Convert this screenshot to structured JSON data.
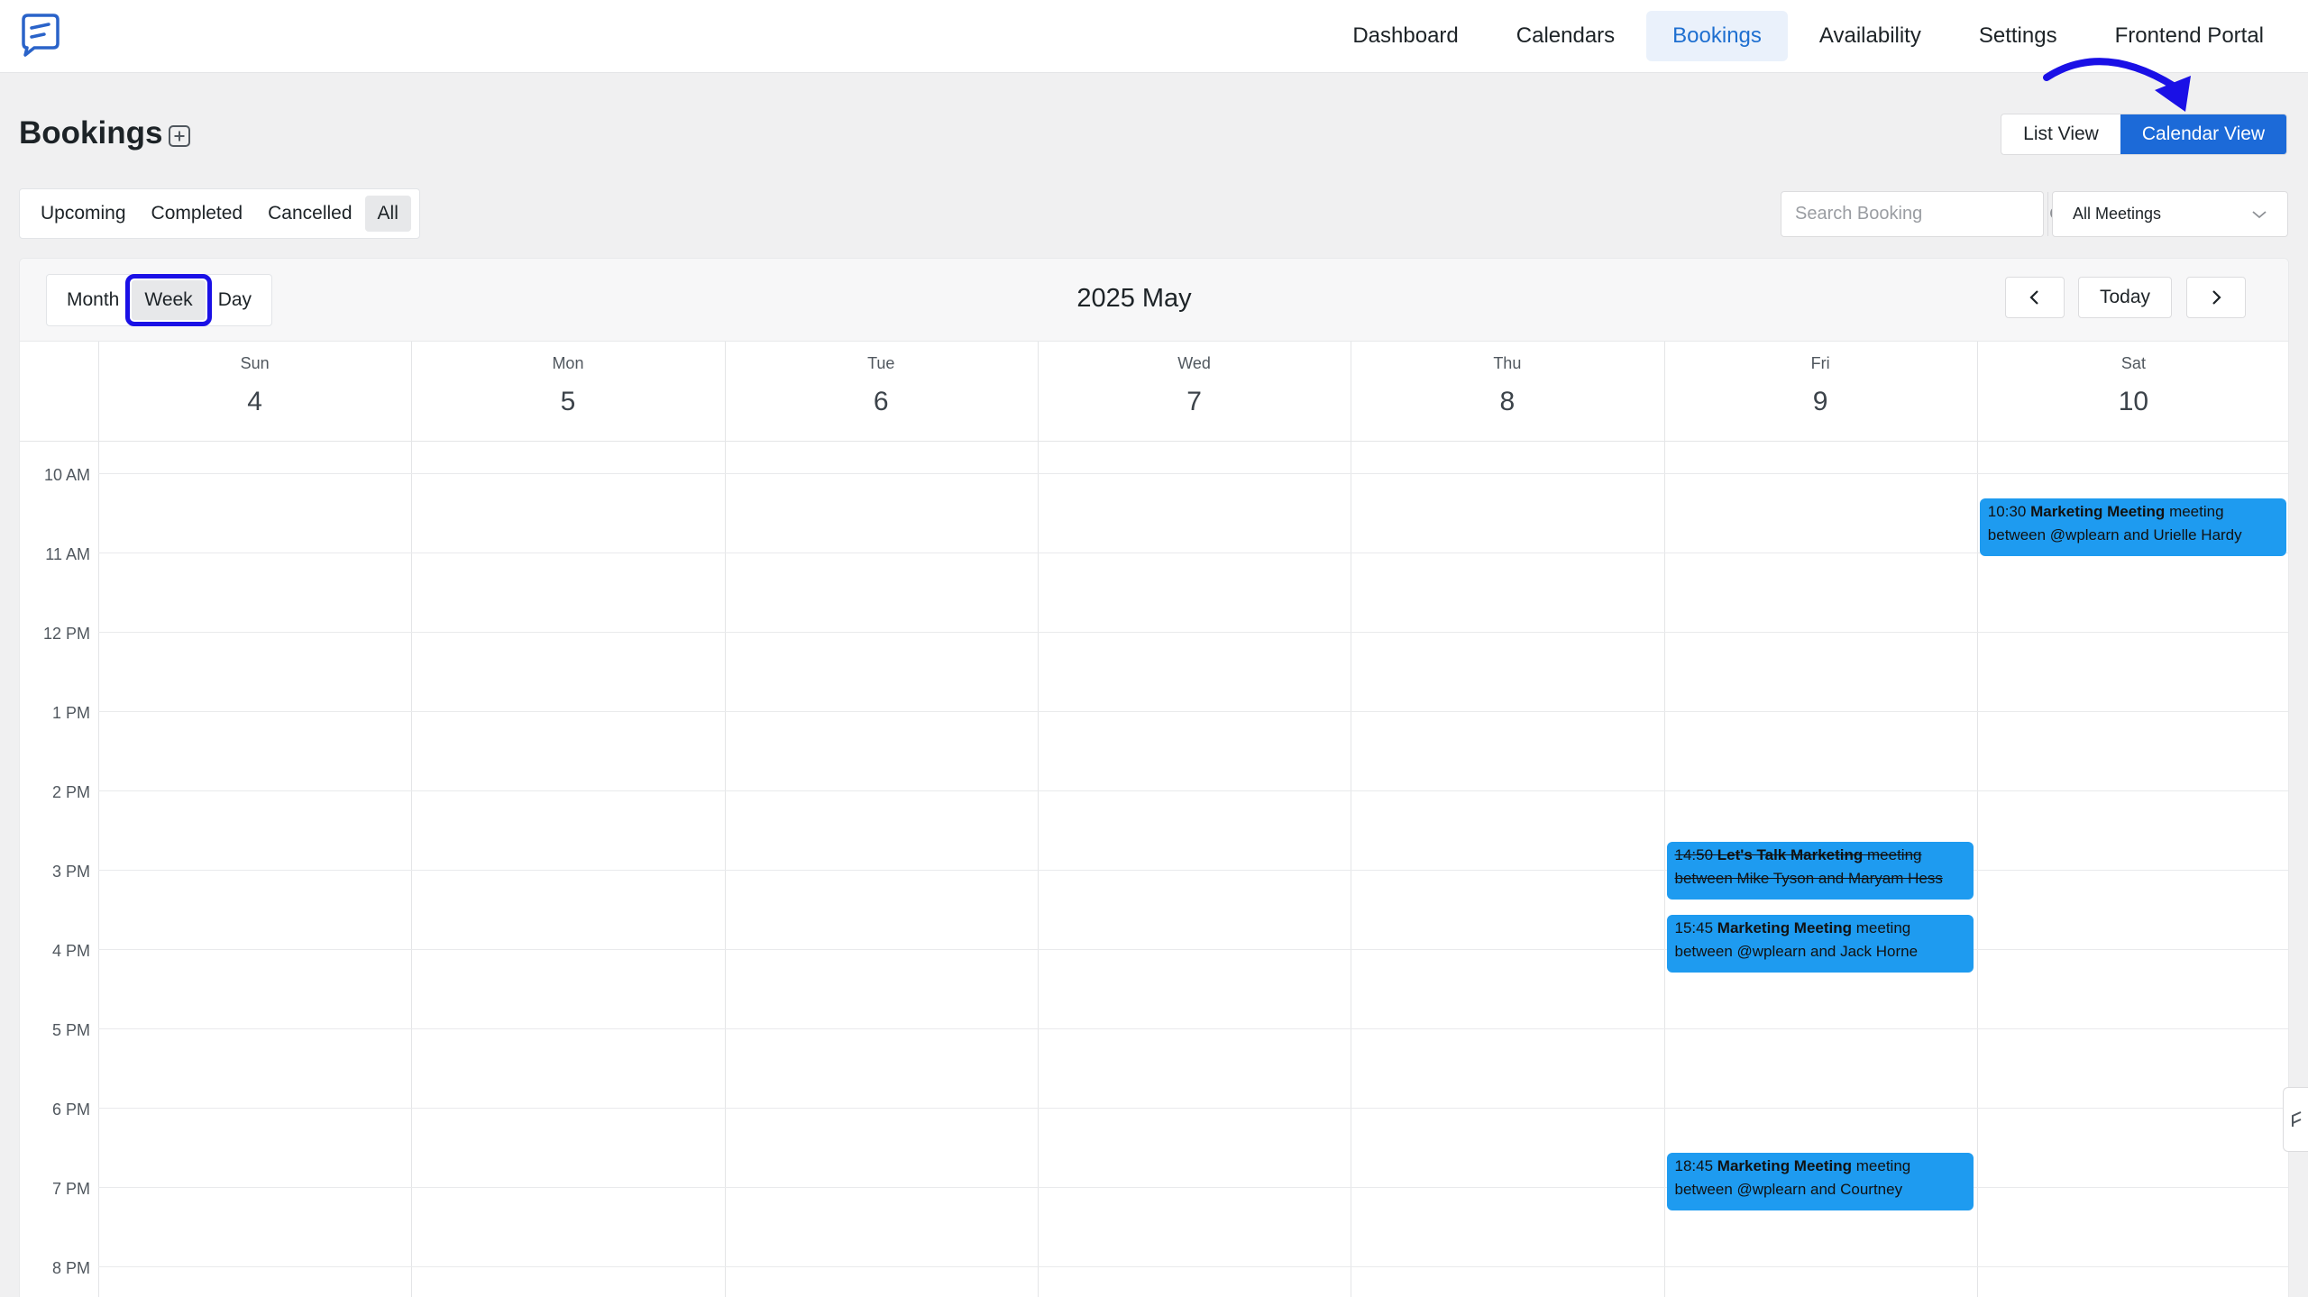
{
  "nav": {
    "items": [
      {
        "label": "Dashboard",
        "active": false
      },
      {
        "label": "Calendars",
        "active": false
      },
      {
        "label": "Bookings",
        "active": true
      },
      {
        "label": "Availability",
        "active": false
      },
      {
        "label": "Settings",
        "active": false
      },
      {
        "label": "Frontend Portal",
        "active": false
      }
    ]
  },
  "header": {
    "title": "Bookings",
    "view_switch": {
      "list": "List View",
      "calendar": "Calendar View"
    }
  },
  "filters": {
    "status_tabs": [
      {
        "label": "Upcoming",
        "active": false
      },
      {
        "label": "Completed",
        "active": false
      },
      {
        "label": "Cancelled",
        "active": false
      },
      {
        "label": "All",
        "active": true
      }
    ],
    "search_placeholder": "Search Booking",
    "meeting_select": "All Meetings"
  },
  "calendar": {
    "range_tabs": [
      {
        "label": "Month",
        "active": false
      },
      {
        "label": "Week",
        "active": true
      },
      {
        "label": "Day",
        "active": false
      }
    ],
    "title": "2025 May",
    "today_label": "Today",
    "days": [
      {
        "name": "Sun",
        "num": "4"
      },
      {
        "name": "Mon",
        "num": "5"
      },
      {
        "name": "Tue",
        "num": "6"
      },
      {
        "name": "Wed",
        "num": "7"
      },
      {
        "name": "Thu",
        "num": "8"
      },
      {
        "name": "Fri",
        "num": "9"
      },
      {
        "name": "Sat",
        "num": "10"
      }
    ],
    "hours": [
      "10 AM",
      "11 AM",
      "12 PM",
      "1 PM",
      "2 PM",
      "3 PM",
      "4 PM",
      "5 PM",
      "6 PM",
      "7 PM",
      "8 PM"
    ],
    "events": [
      {
        "day": "Sat",
        "time": "10:30",
        "title": "Marketing Meeting",
        "desc": "meeting between @wplearn and Urielle Hardy",
        "cancelled": false
      },
      {
        "day": "Fri",
        "time": "14:50",
        "title": "Let's Talk Marketing",
        "desc": "meeting between Mike Tyson and Maryam Hess",
        "cancelled": true
      },
      {
        "day": "Fri",
        "time": "15:45",
        "title": "Marketing Meeting",
        "desc": "meeting between @wplearn and Jack Horne",
        "cancelled": false
      },
      {
        "day": "Fri",
        "time": "18:45",
        "title": "Marketing Meeting",
        "desc": "meeting between @wplearn and Courtney",
        "cancelled": false
      }
    ]
  },
  "colors": {
    "accent": "#1c6ad8",
    "event": "#1e9bf0",
    "highlight_box": "#1a10e6"
  }
}
